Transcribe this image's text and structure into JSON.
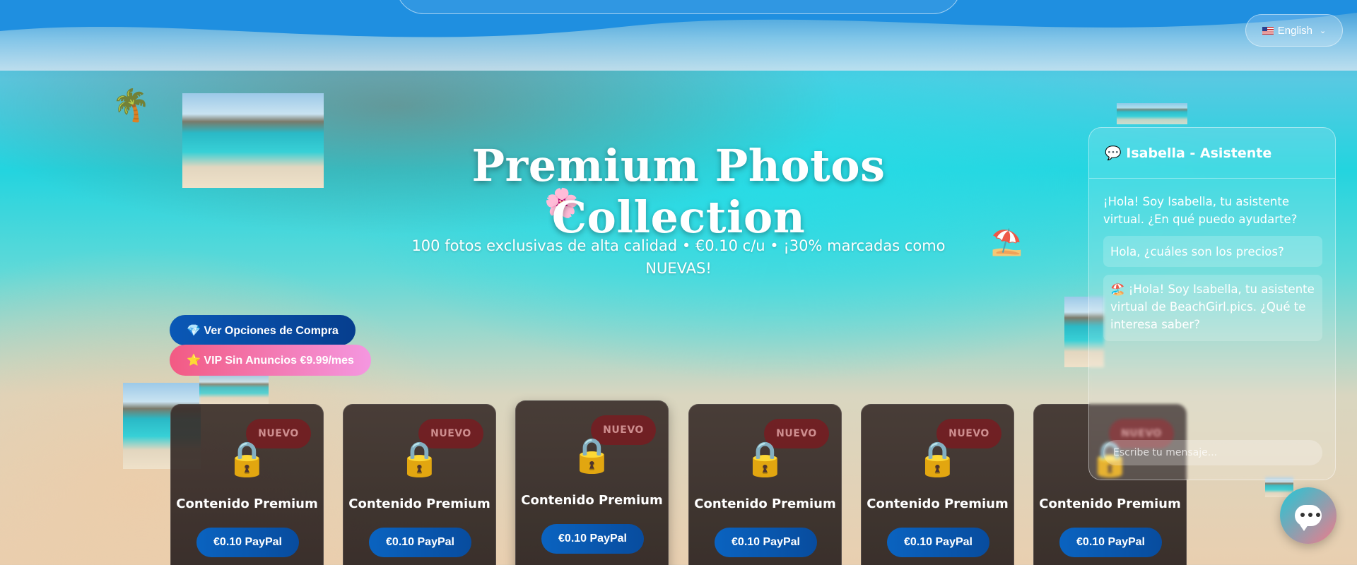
{
  "header": {
    "language": {
      "flag_icon": "us-flag-icon",
      "label": "English"
    }
  },
  "hero": {
    "title": "Premium Photos Collection",
    "subtitle": "100 fotos exclusivas de alta calidad • €0.10 c/u • ¡30% marcadas como NUEVAS!"
  },
  "decorations": {
    "palm": "🌴",
    "flower": "🌸",
    "umbrella": "⛱️"
  },
  "actions": {
    "buy_options": "💎 Ver Opciones de Compra",
    "vip": "⭐ VIP Sin Anuncios €9.99/mes"
  },
  "cards": [
    {
      "badge": "NUEVO",
      "lock": "🔒",
      "title": "Contenido Premium",
      "price": "€0.10 PayPal"
    },
    {
      "badge": "NUEVO",
      "lock": "🔒",
      "title": "Contenido Premium",
      "price": "€0.10 PayPal"
    },
    {
      "badge": "NUEVO",
      "lock": "🔒",
      "title": "Contenido Premium",
      "price": "€0.10 PayPal"
    },
    {
      "badge": "NUEVO",
      "lock": "🔒",
      "title": "Contenido Premium",
      "price": "€0.10 PayPal"
    },
    {
      "badge": "NUEVO",
      "lock": "🔒",
      "title": "Contenido Premium",
      "price": "€0.10 PayPal"
    },
    {
      "badge": "NUEVO",
      "lock": "🔒",
      "title": "Contenido Premium",
      "price": "€0.10 PayPal"
    }
  ],
  "chat": {
    "header": "💬 Isabella - Asistente",
    "messages": [
      "¡Hola! Soy Isabella, tu asistente virtual. ¿En qué puedo ayudarte?",
      "Hola, ¿cuáles son los precios?",
      "🏖️ ¡Hola! Soy Isabella, tu asistente virtual de BeachGirl.pics. ¿Qué te interesa saber?"
    ],
    "input_placeholder": "Escribe tu mensaje...",
    "fab_icon": "chat-bubble-icon"
  },
  "colors": {
    "buy_button": "#0a58b6",
    "vip_button_start": "#f25a83",
    "vip_button_end": "#f497e0",
    "badge": "#82161c",
    "price_button": "#0a63c0"
  }
}
